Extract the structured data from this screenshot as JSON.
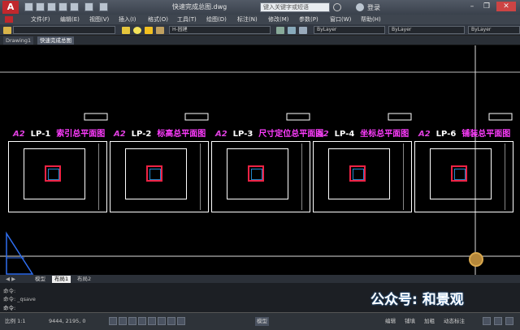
{
  "title": {
    "doc": "快速完成总图.dwg",
    "search_placeholder": "键入关键字或短语",
    "login": "登录",
    "app_logo": "A"
  },
  "menus": [
    "文件(F)",
    "编辑(E)",
    "视图(V)",
    "插入(I)",
    "格式(O)",
    "工具(T)",
    "绘图(D)",
    "标注(N)",
    "修改(M)",
    "参数(P)",
    "窗口(W)",
    "帮助(H)"
  ],
  "toolbar": {
    "layer": "H-园建",
    "color": "ByLayer",
    "linetype": "ByLayer",
    "lineweight": "ByLayer"
  },
  "file_tabs": [
    "Drawing1",
    "快速完成总图"
  ],
  "sheets": [
    {
      "size": "A2",
      "code": "LP-1",
      "name": "索引总平面图"
    },
    {
      "size": "A2",
      "code": "LP-2",
      "name": "标高总平面图"
    },
    {
      "size": "A2",
      "code": "LP-3",
      "name": "尺寸定位总平面图"
    },
    {
      "size": "A2",
      "code": "LP-4",
      "name": "坐标总平面图"
    },
    {
      "size": "A2",
      "code": "LP-6",
      "name": "铺装总平面图"
    }
  ],
  "layout_tabs": [
    "模型",
    "布局1",
    "布局2"
  ],
  "command_history": [
    "命令:",
    "命令: _qsave"
  ],
  "command_prompt": "命令:",
  "status": {
    "scale": "比例 1:1",
    "coords": "9444, 2195, 0",
    "toggles": [
      "模型",
      "编辑",
      "铺填",
      "加粗",
      "动态标注"
    ]
  },
  "watermark": "公众号: 和景观",
  "colors": {
    "accent": "#c0282d",
    "sheet_title": "#ff3cff",
    "sheet_size": "#e040e0"
  }
}
